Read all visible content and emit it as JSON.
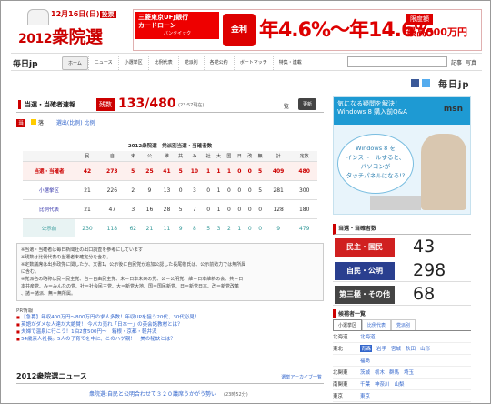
{
  "header": {
    "date_text": "12月16日(日)",
    "vote_label": "投票",
    "logo_year": "2012",
    "logo_text": "衆院選"
  },
  "ad": {
    "bank_name": "三菱東京UFJ銀行",
    "bank_product": "カードローン",
    "bank_sub": "バンクイック",
    "interest_label": "金利",
    "rate_text": "年4.6%〜年14.6%",
    "limit_badge": "限度額",
    "limit_amount": "最高500万円"
  },
  "nav": {
    "site_logo": "毎日jp",
    "tabs": [
      "ホーム",
      "ニュース",
      "小選挙区",
      "比例代表",
      "党派別",
      "各党公約",
      "ボートマッチ",
      "特集・連載"
    ],
    "active_tab": 0,
    "article_link": "記事",
    "web_link": "写真"
  },
  "share": {
    "mainichi_logo": "毎日jp"
  },
  "results": {
    "title": "当選・当確者速報",
    "remaining_label": "残数",
    "count": "133/480",
    "time": "(23:57現在)",
    "list_link": "一覧",
    "update_button": "更新",
    "filter_current": "当",
    "filter_item1": "落",
    "filter_item2": "選出(比例) 比例",
    "table_caption": "2012衆院選　党派別当選・当確者数",
    "columns": [
      "民",
      "自",
      "未",
      "公",
      "維",
      "共",
      "み",
      "社",
      "大",
      "国",
      "日",
      "改",
      "無",
      "計",
      "定数"
    ],
    "rows": [
      {
        "label": "当選・当確者",
        "values": [
          "42",
          "273",
          "5",
          "25",
          "41",
          "5",
          "10",
          "1",
          "1",
          "1",
          "0",
          "0",
          "5",
          "409",
          "480"
        ]
      },
      {
        "label": "小選挙区",
        "values": [
          "21",
          "226",
          "2",
          "9",
          "13",
          "0",
          "3",
          "0",
          "1",
          "0",
          "0",
          "0",
          "5",
          "281",
          "300"
        ]
      },
      {
        "label": "比例代表",
        "values": [
          "21",
          "47",
          "3",
          "16",
          "28",
          "5",
          "7",
          "0",
          "1",
          "0",
          "0",
          "0",
          "0",
          "128",
          "180"
        ]
      },
      {
        "label": "公示前",
        "values": [
          "230",
          "118",
          "62",
          "21",
          "11",
          "9",
          "8",
          "5",
          "3",
          "2",
          "1",
          "0",
          "0",
          "9",
          "479"
        ]
      }
    ],
    "notes": "※当選・当確者は毎日新聞社の出口調査を参考にしています\n※残数は比例代表の当選者未確定分を含む。\n※定数議席は出身政党に関したか、文書1，公示後に自民党が追加公認した長尾敬氏は、公示前勢力では無所属\nに含む。\n※党派名の略称は民＝民主党、自＝自由民主党、未＝日本未来の党、公＝公明党、維＝日本維新の会、共＝日\n本共産党、み＝みんなの党、社＝社会民主党、大＝新党大地、国＝国民新党、日＝新党日本、改＝新党改革\n、諸＝諸派、無＝無所属。",
    "pr_title": "PR情報",
    "pr_items": [
      "【急募】年収400万円〜800万円の求人多数！年収UPを狙う20代、30代必見！",
      "英語がダメな人達が大絶賛！ 今バカ売れ「日本一」の英会話教材とは？",
      "夫婦で温泉に行こう！1泊2食500円〜　箱根・京都・軽井沢",
      "54歳素人社長。5人の子育てを中に、このハゲ親！　美の秘訣とは？"
    ]
  },
  "news": {
    "heading": "2012衆院選ニュース",
    "archive_link": "選挙アーカイブ一覧",
    "item": "衆院選:自民と公明合わせて３２０議席うかがう勢い",
    "item_time": "(23時52分)"
  },
  "ms_ad": {
    "headline": "気になる疑問を解決！\nWindows 8 購入前Q&A",
    "logo": "msn",
    "bubble": "Windows 8 を\nインストールすると、\nパソコンが\nタッチパネルになる!?"
  },
  "candidates": {
    "heading": "当選・当確者数",
    "rows": [
      {
        "label": "民主・国民",
        "count": "43",
        "color": "#d02020"
      },
      {
        "label": "自民・公明",
        "count": "298",
        "color": "#2a3f8f"
      },
      {
        "label": "第三極・その他",
        "count": "68",
        "color": "#444444"
      }
    ]
  },
  "districts": {
    "heading": "候補者一覧",
    "tabs": [
      "小選挙区",
      "比例代表",
      "党派別"
    ],
    "regions": [
      {
        "name": "北海道",
        "prefs": [
          "北海道"
        ]
      },
      {
        "name": "東北",
        "prefs": [
          "青森",
          "岩手",
          "宮城",
          "秋田",
          "山形"
        ]
      },
      {
        "name": "",
        "prefs": [
          "福島"
        ]
      },
      {
        "name": "北関東",
        "prefs": [
          "茨城",
          "栃木",
          "群馬",
          "埼玉"
        ]
      },
      {
        "name": "南関東",
        "prefs": [
          "千葉",
          "神奈川",
          "山梨"
        ]
      },
      {
        "name": "東京",
        "prefs": [
          "東京"
        ]
      }
    ]
  }
}
